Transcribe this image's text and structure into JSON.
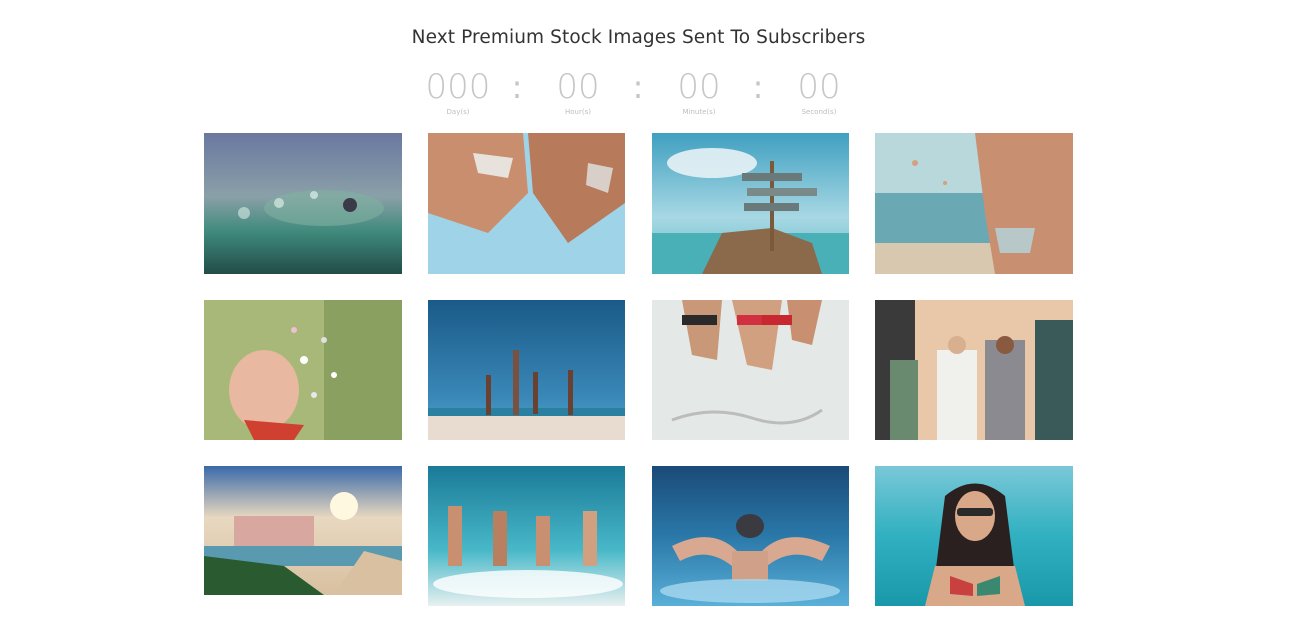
{
  "heading": "Next Premium Stock Images Sent To Subscribers",
  "countdown": {
    "days": {
      "value": "000",
      "label": "Day(s)"
    },
    "hours": {
      "value": "00",
      "label": "Hour(s)"
    },
    "minutes": {
      "value": "00",
      "label": "Minute(s)"
    },
    "seconds": {
      "value": "00",
      "label": "Second(s)"
    },
    "separator": ":"
  },
  "colors": {
    "heading_text": "#333333",
    "countdown_text": "#c6c6c6",
    "background": "#ffffff"
  }
}
